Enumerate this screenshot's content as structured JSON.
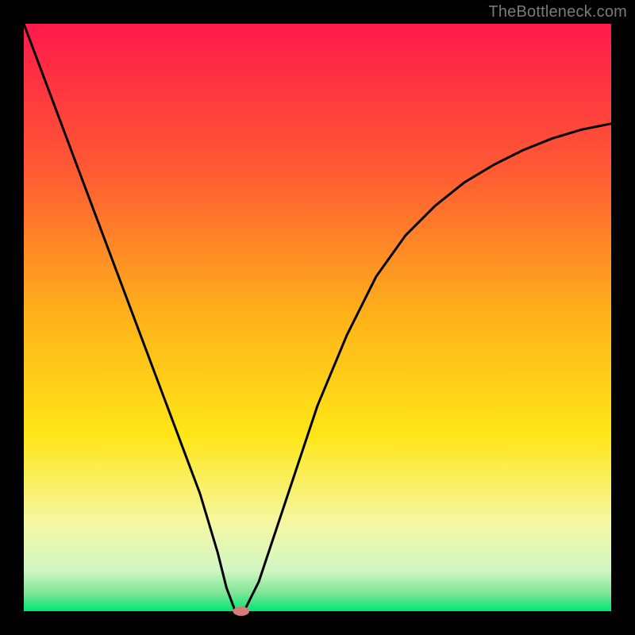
{
  "watermark": "TheBottleneck.com",
  "chart_data": {
    "type": "line",
    "title": "",
    "xlabel": "",
    "ylabel": "",
    "xlim": [
      0,
      100
    ],
    "ylim": [
      0,
      100
    ],
    "background_gradient": {
      "type": "vertical",
      "stops": [
        {
          "offset": 0.0,
          "color": "#ff1a4b"
        },
        {
          "offset": 0.25,
          "color": "#ff5a33"
        },
        {
          "offset": 0.5,
          "color": "#ffb31a"
        },
        {
          "offset": 0.7,
          "color": "#ffe617"
        },
        {
          "offset": 0.85,
          "color": "#f5f7a3"
        },
        {
          "offset": 0.93,
          "color": "#d1f7c4"
        },
        {
          "offset": 0.97,
          "color": "#7be495"
        },
        {
          "offset": 1.0,
          "color": "#00e676"
        }
      ]
    },
    "series": [
      {
        "name": "bottleneck_curve",
        "type": "line",
        "color": "#000000",
        "x": [
          0,
          3,
          6,
          9,
          12,
          15,
          18,
          21,
          24,
          27,
          30,
          33,
          34.5,
          36,
          37.5,
          40,
          45,
          50,
          55,
          60,
          65,
          70,
          75,
          80,
          85,
          90,
          95,
          100
        ],
        "values": [
          100,
          92,
          84,
          76,
          68,
          60,
          52,
          44,
          36,
          28,
          20,
          10,
          4,
          0,
          0,
          5,
          20,
          35,
          47,
          57,
          64,
          69,
          73,
          76,
          78.5,
          80.5,
          82,
          83
        ]
      }
    ],
    "marker": {
      "x": 37,
      "y": 0,
      "rx": 1.4,
      "ry": 0.8,
      "color": "#d97a7a"
    },
    "frame": {
      "inner_left": 30,
      "inner_top": 30,
      "inner_width": 740,
      "inner_height": 740,
      "border_color": "#000000"
    }
  }
}
